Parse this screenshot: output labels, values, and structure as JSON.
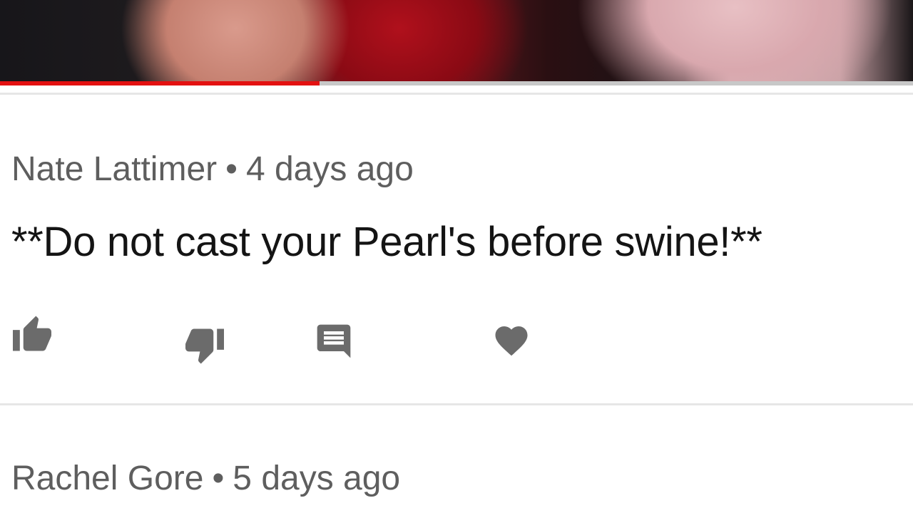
{
  "video": {
    "progress_percent": 35
  },
  "comments": [
    {
      "author": "Nate Lattimer",
      "separator": "•",
      "time": "4 days ago",
      "text": "**Do not cast your Pearl's before swine!**",
      "actions": {
        "like_icon": "thumbs-up-icon",
        "dislike_icon": "thumbs-down-icon",
        "reply_icon": "comment-icon",
        "heart_icon": "heart-icon"
      }
    },
    {
      "author": "Rachel Gore",
      "separator": "•",
      "time": "5 days ago"
    }
  ],
  "colors": {
    "progress": "#e31111",
    "track": "#c8c8c8",
    "icon": "#6b6b6b",
    "meta_text": "#5e5e5e",
    "body_text": "#141414"
  }
}
